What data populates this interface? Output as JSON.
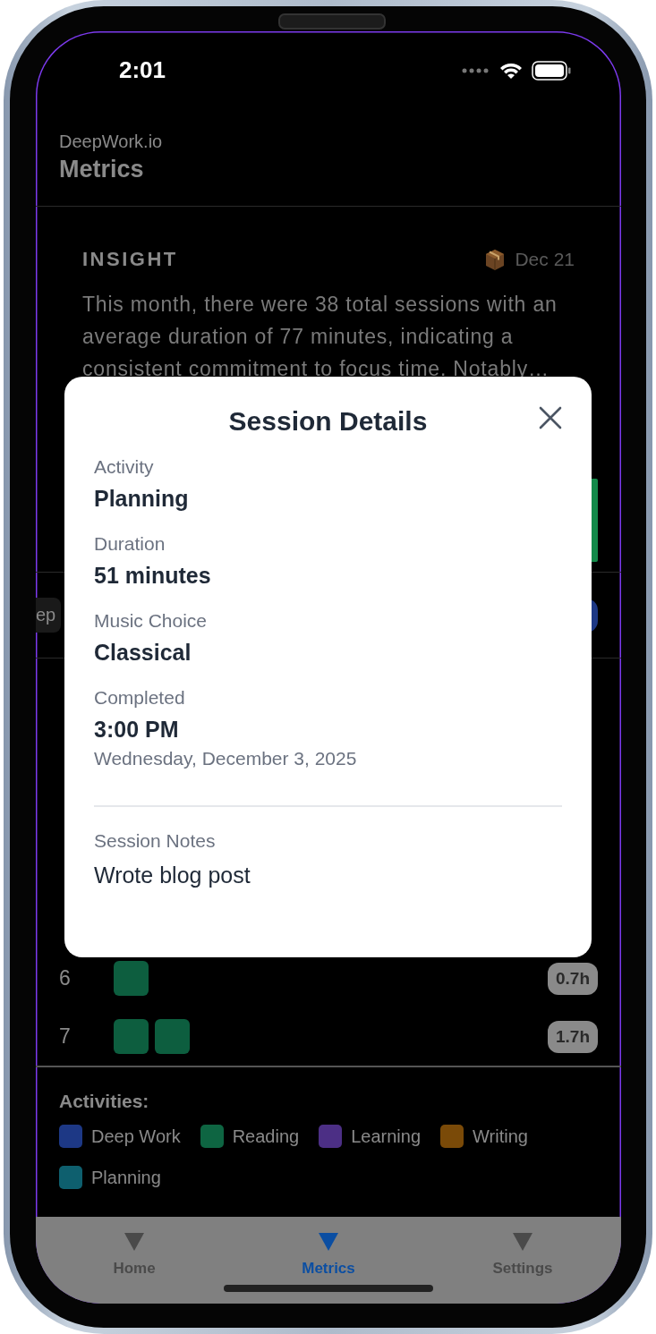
{
  "status_bar": {
    "time": "2:01"
  },
  "header": {
    "app_name": "DeepWork.io",
    "title": "Metrics"
  },
  "insight": {
    "label": "INSIGHT",
    "date": "Dec 21",
    "text": "This month, there were 38 total sessions with an average duration of 77 minutes, indicating a consistent commitment to focus time. Notably…"
  },
  "filter_chip": {
    "label": "ep"
  },
  "day_rows": [
    {
      "day": "6",
      "blocks": [
        {
          "color": "#0d5e3f"
        }
      ],
      "hours": "0.7h"
    },
    {
      "day": "7",
      "blocks": [
        {
          "color": "#0d5e3f"
        },
        {
          "color": "#0d5e3f"
        }
      ],
      "hours": "1.7h"
    }
  ],
  "legend": {
    "title": "Activities:",
    "items": [
      {
        "label": "Deep Work",
        "color": "#1d3885"
      },
      {
        "label": "Reading",
        "color": "#0e6542"
      },
      {
        "label": "Learning",
        "color": "#4c2f85"
      },
      {
        "label": "Writing",
        "color": "#7a4a08"
      },
      {
        "label": "Planning",
        "color": "#0e5f6e"
      }
    ]
  },
  "tabs": [
    {
      "label": "Home",
      "selected": false
    },
    {
      "label": "Metrics",
      "selected": true
    },
    {
      "label": "Settings",
      "selected": false
    }
  ],
  "modal": {
    "title": "Session Details",
    "fields": [
      {
        "label": "Activity",
        "value": "Planning"
      },
      {
        "label": "Duration",
        "value": "51 minutes"
      },
      {
        "label": "Music Choice",
        "value": "Classical"
      },
      {
        "label": "Completed",
        "value": "3:00 PM",
        "detail": "Wednesday, December 3, 2025"
      }
    ],
    "notes_label": "Session Notes",
    "notes": "Wrote blog post"
  }
}
